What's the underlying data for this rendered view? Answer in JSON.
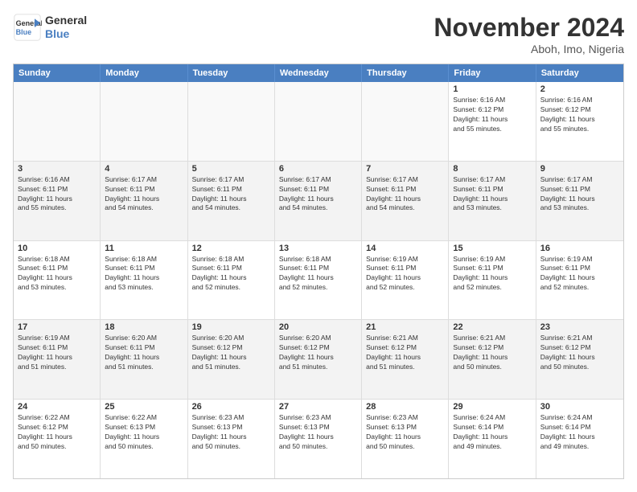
{
  "logo": {
    "line1": "General",
    "line2": "Blue"
  },
  "title": "November 2024",
  "subtitle": "Aboh, Imo, Nigeria",
  "days_of_week": [
    "Sunday",
    "Monday",
    "Tuesday",
    "Wednesday",
    "Thursday",
    "Friday",
    "Saturday"
  ],
  "weeks": [
    [
      {
        "day": "",
        "empty": true
      },
      {
        "day": "",
        "empty": true
      },
      {
        "day": "",
        "empty": true
      },
      {
        "day": "",
        "empty": true
      },
      {
        "day": "",
        "empty": true
      },
      {
        "day": "1",
        "info": "Sunrise: 6:16 AM\nSunset: 6:12 PM\nDaylight: 11 hours\nand 55 minutes."
      },
      {
        "day": "2",
        "info": "Sunrise: 6:16 AM\nSunset: 6:12 PM\nDaylight: 11 hours\nand 55 minutes."
      }
    ],
    [
      {
        "day": "3",
        "info": "Sunrise: 6:16 AM\nSunset: 6:11 PM\nDaylight: 11 hours\nand 55 minutes."
      },
      {
        "day": "4",
        "info": "Sunrise: 6:17 AM\nSunset: 6:11 PM\nDaylight: 11 hours\nand 54 minutes."
      },
      {
        "day": "5",
        "info": "Sunrise: 6:17 AM\nSunset: 6:11 PM\nDaylight: 11 hours\nand 54 minutes."
      },
      {
        "day": "6",
        "info": "Sunrise: 6:17 AM\nSunset: 6:11 PM\nDaylight: 11 hours\nand 54 minutes."
      },
      {
        "day": "7",
        "info": "Sunrise: 6:17 AM\nSunset: 6:11 PM\nDaylight: 11 hours\nand 54 minutes."
      },
      {
        "day": "8",
        "info": "Sunrise: 6:17 AM\nSunset: 6:11 PM\nDaylight: 11 hours\nand 53 minutes."
      },
      {
        "day": "9",
        "info": "Sunrise: 6:17 AM\nSunset: 6:11 PM\nDaylight: 11 hours\nand 53 minutes."
      }
    ],
    [
      {
        "day": "10",
        "info": "Sunrise: 6:18 AM\nSunset: 6:11 PM\nDaylight: 11 hours\nand 53 minutes."
      },
      {
        "day": "11",
        "info": "Sunrise: 6:18 AM\nSunset: 6:11 PM\nDaylight: 11 hours\nand 53 minutes."
      },
      {
        "day": "12",
        "info": "Sunrise: 6:18 AM\nSunset: 6:11 PM\nDaylight: 11 hours\nand 52 minutes."
      },
      {
        "day": "13",
        "info": "Sunrise: 6:18 AM\nSunset: 6:11 PM\nDaylight: 11 hours\nand 52 minutes."
      },
      {
        "day": "14",
        "info": "Sunrise: 6:19 AM\nSunset: 6:11 PM\nDaylight: 11 hours\nand 52 minutes."
      },
      {
        "day": "15",
        "info": "Sunrise: 6:19 AM\nSunset: 6:11 PM\nDaylight: 11 hours\nand 52 minutes."
      },
      {
        "day": "16",
        "info": "Sunrise: 6:19 AM\nSunset: 6:11 PM\nDaylight: 11 hours\nand 52 minutes."
      }
    ],
    [
      {
        "day": "17",
        "info": "Sunrise: 6:19 AM\nSunset: 6:11 PM\nDaylight: 11 hours\nand 51 minutes."
      },
      {
        "day": "18",
        "info": "Sunrise: 6:20 AM\nSunset: 6:11 PM\nDaylight: 11 hours\nand 51 minutes."
      },
      {
        "day": "19",
        "info": "Sunrise: 6:20 AM\nSunset: 6:12 PM\nDaylight: 11 hours\nand 51 minutes."
      },
      {
        "day": "20",
        "info": "Sunrise: 6:20 AM\nSunset: 6:12 PM\nDaylight: 11 hours\nand 51 minutes."
      },
      {
        "day": "21",
        "info": "Sunrise: 6:21 AM\nSunset: 6:12 PM\nDaylight: 11 hours\nand 51 minutes."
      },
      {
        "day": "22",
        "info": "Sunrise: 6:21 AM\nSunset: 6:12 PM\nDaylight: 11 hours\nand 50 minutes."
      },
      {
        "day": "23",
        "info": "Sunrise: 6:21 AM\nSunset: 6:12 PM\nDaylight: 11 hours\nand 50 minutes."
      }
    ],
    [
      {
        "day": "24",
        "info": "Sunrise: 6:22 AM\nSunset: 6:12 PM\nDaylight: 11 hours\nand 50 minutes."
      },
      {
        "day": "25",
        "info": "Sunrise: 6:22 AM\nSunset: 6:13 PM\nDaylight: 11 hours\nand 50 minutes."
      },
      {
        "day": "26",
        "info": "Sunrise: 6:23 AM\nSunset: 6:13 PM\nDaylight: 11 hours\nand 50 minutes."
      },
      {
        "day": "27",
        "info": "Sunrise: 6:23 AM\nSunset: 6:13 PM\nDaylight: 11 hours\nand 50 minutes."
      },
      {
        "day": "28",
        "info": "Sunrise: 6:23 AM\nSunset: 6:13 PM\nDaylight: 11 hours\nand 50 minutes."
      },
      {
        "day": "29",
        "info": "Sunrise: 6:24 AM\nSunset: 6:14 PM\nDaylight: 11 hours\nand 49 minutes."
      },
      {
        "day": "30",
        "info": "Sunrise: 6:24 AM\nSunset: 6:14 PM\nDaylight: 11 hours\nand 49 minutes."
      }
    ]
  ]
}
